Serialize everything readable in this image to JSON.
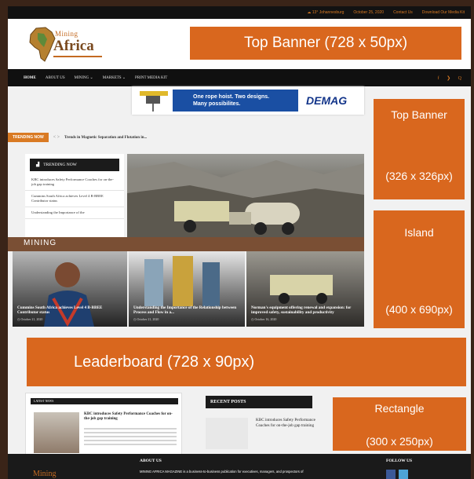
{
  "topbar": {
    "weather": "13",
    "location": "Johannesburg",
    "date": "October 25, 2020",
    "contact": "Contact Us",
    "download": "Download Our Media Kit"
  },
  "logo": {
    "line1": "Mining",
    "line2": "Africa"
  },
  "banners": {
    "top_banner_728": "Top Banner (728 x 50px)",
    "side_top_title": "Top Banner",
    "side_top_size": "(326 x 326px)",
    "island_title": "Island",
    "island_size": "(400 x 690px)",
    "leaderboard": "Leaderboard (728 x 90px)",
    "rectangle_title": "Rectangle",
    "rectangle_size": "(300 x 250px)"
  },
  "nav": {
    "items": [
      "HOME",
      "ABOUT US",
      "MINING",
      "MARKETS",
      "PRINT MEDIA KIT"
    ],
    "social": "f ❯ Q"
  },
  "ad": {
    "line1": "One rope hoist. Two designs.",
    "line2": "Many possibilites.",
    "brand": "DEMAG"
  },
  "trending_bar": {
    "tag": "TRENDING NOW",
    "arrows": "< >",
    "headline": "Trends in Magnetic Separation and Flotation in..."
  },
  "trending_box": {
    "title": "TRENDING NOW",
    "items": [
      "KBC introduces Safety Performance Coaches for on-the-job gap training",
      "Cummins South Africa achieves Level 4 B-BBEE Contributor status",
      "Understanding the Importance of the"
    ]
  },
  "section": {
    "label": "MINING"
  },
  "cards": [
    {
      "title": "Cummins South Africa achieves Level 4 B-BBEE Contributor status",
      "meta": "October 21, 2020"
    },
    {
      "title": "Understanding the Importance of the Relationship between Process and Flow in a...",
      "meta": "October 21, 2020"
    },
    {
      "title": "Norman's equipment offering renewal and expansion: for improved safety, sustainability and productivity",
      "meta": "October 16, 2020"
    }
  ],
  "bottom_panel": {
    "header": "LATEST NEWS",
    "title": "KBC introduces Safety Performance Coaches for on-the-job gap training"
  },
  "recent": {
    "title": "RECENT POSTS",
    "item": "KBC introduces Safety Performance Coaches for on-the-job gap training"
  },
  "footer": {
    "about_title": "ABOUT US",
    "about_text": "MINING AFRICA MAGAZINE is a business-to-business publication for executives, managers, and prospectors of",
    "follow_title": "FOLLOW US",
    "logo_text": "Mining"
  },
  "colors": {
    "accent_orange": "#d9671e",
    "frame_brown": "#3a2418",
    "mining_strip": "#7a4f34",
    "demag_blue": "#1a4fa3"
  }
}
